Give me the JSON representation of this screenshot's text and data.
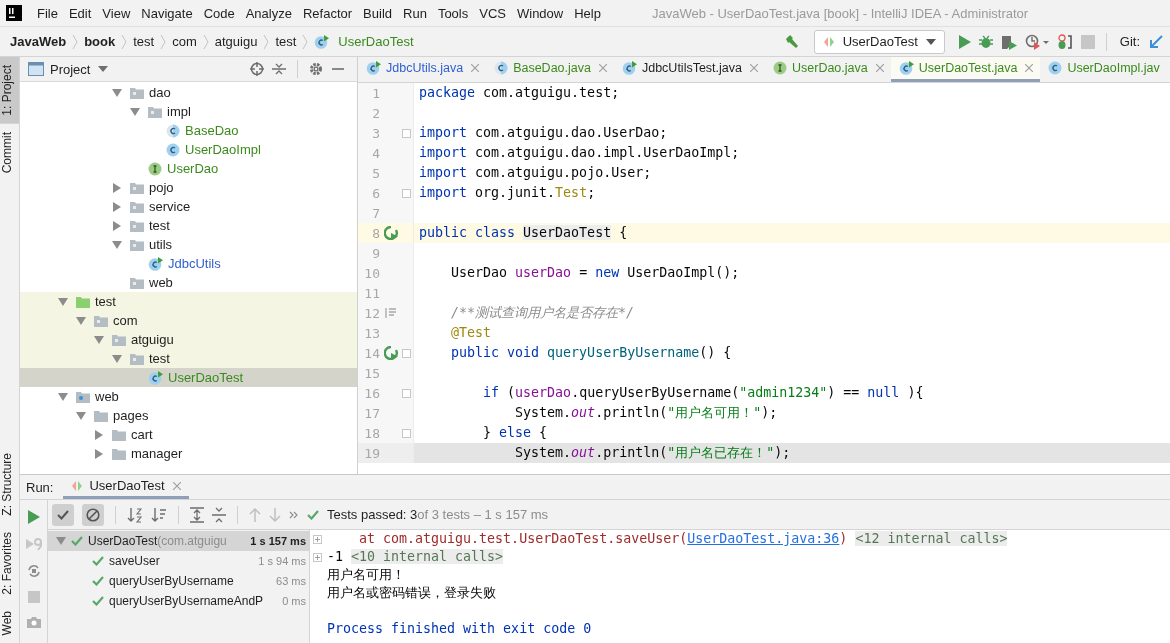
{
  "window": {
    "title": "JavaWeb - UserDaoTest.java [book] - IntelliJ IDEA - Administrator"
  },
  "menu": [
    {
      "label": "File"
    },
    {
      "label": "Edit"
    },
    {
      "label": "View"
    },
    {
      "label": "Navigate"
    },
    {
      "label": "Code"
    },
    {
      "label": "Analyze"
    },
    {
      "label": "Refactor"
    },
    {
      "label": "Build"
    },
    {
      "label": "Run"
    },
    {
      "label": "Tools"
    },
    {
      "label": "VCS"
    },
    {
      "label": "Window"
    },
    {
      "label": "Help"
    }
  ],
  "breadcrumbs": [
    {
      "label": "JavaWeb",
      "kind": "module"
    },
    {
      "label": "book",
      "kind": "module"
    },
    {
      "label": "test",
      "kind": "package"
    },
    {
      "label": "com",
      "kind": "package"
    },
    {
      "label": "atguigu",
      "kind": "package"
    },
    {
      "label": "test",
      "kind": "package"
    },
    {
      "label": "UserDaoTest",
      "kind": "class"
    }
  ],
  "toolbar": {
    "run_config": "UserDaoTest",
    "vcs_label": "Git:",
    "stop_disabled": true
  },
  "side_tabs_top": [
    {
      "label": "1: Project",
      "selected": true
    },
    {
      "label": "Commit",
      "selected": false
    }
  ],
  "side_tabs_bottom": [
    {
      "label": "Z: Structure",
      "selected": false
    },
    {
      "label": "2: Favorites",
      "selected": false
    },
    {
      "label": "Web",
      "selected": false
    }
  ],
  "project": {
    "title": "Project",
    "tree": {
      "scrolled_branch": [
        {
          "name": "dao",
          "kind": "package",
          "expanded": true,
          "selected": false,
          "highlighted": false,
          "color": "#1f1f1f",
          "children": [
            {
              "name": "impl",
              "kind": "package",
              "expanded": true,
              "selected": false,
              "highlighted": false,
              "color": "#1f1f1f",
              "children": [
                {
                  "name": "BaseDao",
                  "kind": "abstract-class",
                  "selected": false,
                  "highlighted": false,
                  "color": "#3b8a1d"
                },
                {
                  "name": "UserDaoImpl",
                  "kind": "class",
                  "selected": false,
                  "highlighted": false,
                  "color": "#3b8a1d"
                }
              ]
            },
            {
              "name": "UserDao",
              "kind": "interface",
              "selected": false,
              "highlighted": false,
              "color": "#3b8a1d"
            }
          ]
        },
        {
          "name": "pojo",
          "kind": "package",
          "expanded": false,
          "selected": false,
          "highlighted": false,
          "color": "#1f1f1f"
        },
        {
          "name": "service",
          "kind": "package",
          "expanded": false,
          "selected": false,
          "highlighted": false,
          "color": "#1f1f1f"
        },
        {
          "name": "test",
          "kind": "package",
          "expanded": false,
          "selected": false,
          "highlighted": false,
          "color": "#1f1f1f"
        },
        {
          "name": "utils",
          "kind": "package",
          "expanded": true,
          "selected": false,
          "highlighted": false,
          "color": "#1f1f1f",
          "children": [
            {
              "name": "JdbcUtils",
              "kind": "runnable-class",
              "selected": false,
              "highlighted": false,
              "color": "#2f5fd0"
            }
          ]
        },
        {
          "name": "web",
          "kind": "package",
          "selected": false,
          "highlighted": false,
          "color": "#1f1f1f"
        }
      ],
      "items": [
        {
          "name": "test",
          "kind": "test-root",
          "expanded": true,
          "selected": false,
          "highlighted": true,
          "color": "#1f1f1f",
          "children": [
            {
              "name": "com",
              "kind": "package",
              "expanded": true,
              "selected": false,
              "highlighted": true,
              "color": "#1f1f1f",
              "children": [
                {
                  "name": "atguigu",
                  "kind": "package",
                  "expanded": true,
                  "selected": false,
                  "highlighted": true,
                  "color": "#1f1f1f",
                  "children": [
                    {
                      "name": "test",
                      "kind": "package",
                      "expanded": true,
                      "selected": false,
                      "highlighted": true,
                      "color": "#1f1f1f",
                      "children": [
                        {
                          "name": "UserDaoTest",
                          "kind": "runnable-class",
                          "selected": true,
                          "highlighted": true,
                          "color": "#3b8a1d"
                        }
                      ]
                    }
                  ]
                }
              ]
            }
          ]
        },
        {
          "name": "web",
          "kind": "web-root",
          "expanded": true,
          "selected": false,
          "highlighted": false,
          "color": "#1f1f1f",
          "children": [
            {
              "name": "pages",
              "kind": "folder",
              "expanded": true,
              "selected": false,
              "highlighted": false,
              "color": "#1f1f1f",
              "children": [
                {
                  "name": "cart",
                  "kind": "folder",
                  "expanded": false,
                  "selected": false,
                  "highlighted": false,
                  "color": "#1f1f1f"
                },
                {
                  "name": "manager",
                  "kind": "folder",
                  "expanded": false,
                  "selected": false,
                  "highlighted": false,
                  "color": "#1f1f1f"
                }
              ]
            }
          ]
        }
      ]
    }
  },
  "editor": {
    "tabs": [
      {
        "label": "JdbcUtils.java",
        "kind": "runnable-class",
        "color": "#2f5fd0",
        "selected": false,
        "closable": true
      },
      {
        "label": "BaseDao.java",
        "kind": "abstract-class",
        "color": "#3b8a1d",
        "selected": false,
        "closable": true
      },
      {
        "label": "JdbcUtilsTest.java",
        "kind": "runnable-class",
        "color": "#1f1f1f",
        "selected": false,
        "closable": true
      },
      {
        "label": "UserDao.java",
        "kind": "interface",
        "color": "#3b8a1d",
        "selected": false,
        "closable": true
      },
      {
        "label": "UserDaoTest.java",
        "kind": "runnable-class",
        "color": "#3b8a1d",
        "selected": true,
        "closable": true
      },
      {
        "label": "UserDaoImpl.jav",
        "kind": "class",
        "color": "#3b8a1d",
        "selected": false,
        "closable": false
      }
    ],
    "lines": [
      {
        "number": "1",
        "run_marker": false,
        "doc_marker": false,
        "fold": false,
        "caret_line": false,
        "selected": false,
        "tokens": [
          {
            "kind": "keyword",
            "text": "package"
          },
          {
            "kind": "plain",
            "text": " com.atguigu.test;"
          }
        ]
      },
      {
        "number": "2",
        "run_marker": false,
        "doc_marker": false,
        "fold": false,
        "caret_line": false,
        "selected": false
      },
      {
        "number": "3",
        "run_marker": false,
        "doc_marker": false,
        "fold": true,
        "caret_line": false,
        "selected": false,
        "tokens": [
          {
            "kind": "keyword",
            "text": "import"
          },
          {
            "kind": "plain",
            "text": " com.atguigu.dao.UserDao;"
          }
        ]
      },
      {
        "number": "4",
        "run_marker": false,
        "doc_marker": false,
        "fold": false,
        "caret_line": false,
        "selected": false,
        "tokens": [
          {
            "kind": "keyword",
            "text": "import"
          },
          {
            "kind": "plain",
            "text": " com.atguigu.dao.impl.UserDaoImpl;"
          }
        ]
      },
      {
        "number": "5",
        "run_marker": false,
        "doc_marker": false,
        "fold": false,
        "caret_line": false,
        "selected": false,
        "tokens": [
          {
            "kind": "keyword",
            "text": "import"
          },
          {
            "kind": "plain",
            "text": " com.atguigu.pojo.User;"
          }
        ]
      },
      {
        "number": "6",
        "run_marker": false,
        "doc_marker": false,
        "fold": true,
        "caret_line": false,
        "selected": false,
        "tokens": [
          {
            "kind": "keyword",
            "text": "import"
          },
          {
            "kind": "plain",
            "text": " org.junit."
          },
          {
            "kind": "annotation",
            "text": "Test"
          },
          {
            "kind": "plain",
            "text": ";"
          }
        ]
      },
      {
        "number": "7",
        "run_marker": false,
        "doc_marker": false,
        "fold": false,
        "caret_line": false,
        "selected": false
      },
      {
        "number": "8",
        "run_marker": true,
        "doc_marker": false,
        "fold": false,
        "caret_line": true,
        "selected": false,
        "tokens": [
          {
            "kind": "keyword",
            "text": "public class "
          },
          {
            "kind": "usage",
            "text": "UserDaoTest"
          },
          {
            "kind": "plain",
            "text": " {"
          }
        ]
      },
      {
        "number": "9",
        "run_marker": false,
        "doc_marker": false,
        "fold": false,
        "caret_line": false,
        "selected": false
      },
      {
        "number": "10",
        "run_marker": false,
        "doc_marker": false,
        "fold": false,
        "caret_line": false,
        "selected": false,
        "tokens": [
          {
            "kind": "plain",
            "text": "    UserDao "
          },
          {
            "kind": "field",
            "text": "userDao"
          },
          {
            "kind": "plain",
            "text": " = "
          },
          {
            "kind": "keyword",
            "text": "new"
          },
          {
            "kind": "plain",
            "text": " UserDaoImpl();"
          }
        ]
      },
      {
        "number": "11",
        "run_marker": false,
        "doc_marker": false,
        "fold": false,
        "caret_line": false,
        "selected": false
      },
      {
        "number": "12",
        "run_marker": false,
        "doc_marker": true,
        "fold": false,
        "caret_line": false,
        "selected": false,
        "tokens": [
          {
            "kind": "comment",
            "text": "    /**测试查询用户名是否存在*/"
          }
        ]
      },
      {
        "number": "13",
        "run_marker": false,
        "doc_marker": false,
        "fold": false,
        "caret_line": false,
        "selected": false,
        "tokens": [
          {
            "kind": "annotation",
            "text": "    @Test"
          }
        ]
      },
      {
        "number": "14",
        "run_marker": true,
        "doc_marker": false,
        "fold": true,
        "caret_line": false,
        "selected": false,
        "tokens": [
          {
            "kind": "keyword",
            "text": "    public void "
          },
          {
            "kind": "method",
            "text": "queryUserByUsername"
          },
          {
            "kind": "plain",
            "text": "() {"
          }
        ]
      },
      {
        "number": "15",
        "run_marker": false,
        "doc_marker": false,
        "fold": false,
        "caret_line": false,
        "selected": false
      },
      {
        "number": "16",
        "run_marker": false,
        "doc_marker": false,
        "fold": true,
        "caret_line": false,
        "selected": false,
        "tokens": [
          {
            "kind": "keyword",
            "text": "        if"
          },
          {
            "kind": "plain",
            "text": " ("
          },
          {
            "kind": "field",
            "text": "userDao"
          },
          {
            "kind": "plain",
            "text": ".queryUserByUsername("
          },
          {
            "kind": "string",
            "text": "\"admin1234\""
          },
          {
            "kind": "plain",
            "text": ") == "
          },
          {
            "kind": "keyword",
            "text": "null"
          },
          {
            "kind": "plain",
            "text": " ){"
          }
        ]
      },
      {
        "number": "17",
        "run_marker": false,
        "doc_marker": false,
        "fold": false,
        "caret_line": false,
        "selected": false,
        "tokens": [
          {
            "kind": "plain",
            "text": "            System."
          },
          {
            "kind": "static",
            "text": "out"
          },
          {
            "kind": "plain",
            "text": ".println("
          },
          {
            "kind": "string",
            "text": "\"用户名可用！\""
          },
          {
            "kind": "plain",
            "text": ");"
          }
        ]
      },
      {
        "number": "18",
        "run_marker": false,
        "doc_marker": false,
        "fold": true,
        "caret_line": false,
        "selected": false,
        "tokens": [
          {
            "kind": "plain",
            "text": "        } "
          },
          {
            "kind": "keyword",
            "text": "else"
          },
          {
            "kind": "plain",
            "text": " {"
          }
        ]
      },
      {
        "number": "19",
        "run_marker": false,
        "doc_marker": false,
        "fold": false,
        "caret_line": false,
        "selected": true,
        "tokens": [
          {
            "kind": "plain",
            "text": "            System."
          },
          {
            "kind": "static",
            "text": "out"
          },
          {
            "kind": "plain",
            "text": ".println("
          },
          {
            "kind": "string",
            "text": "\"用户名已存在！\""
          },
          {
            "kind": "plain",
            "text": ");"
          }
        ]
      }
    ]
  },
  "run": {
    "label": "Run:",
    "tab": {
      "label": "UserDaoTest",
      "selected": true
    },
    "filters": {
      "show_passed": true,
      "show_ignored": true
    },
    "status": {
      "summary": "Tests passed: 3",
      "detail": "of 3 tests – 1 s 157 ms"
    },
    "tests": [
      {
        "name": "UserDaoTest",
        "detail": "(com.atguigu",
        "time": "1 s 157 ms",
        "passed": true,
        "selected": true,
        "children": [
          {
            "name": "saveUser",
            "time": "1 s 94 ms",
            "passed": true,
            "selected": false
          },
          {
            "name": "queryUserByUsername",
            "time": "63 ms",
            "passed": true,
            "selected": false
          },
          {
            "name": "queryUserByUsernameAndP",
            "time": "0 ms",
            "passed": true,
            "selected": false
          }
        ]
      }
    ],
    "console": [
      {
        "fold": true,
        "segments": [
          {
            "kind": "error",
            "text": "    at com.atguigu.test.UserDaoTest.saveUser("
          },
          {
            "kind": "link",
            "text": "UserDaoTest.java:36"
          },
          {
            "kind": "error",
            "text": ")"
          },
          {
            "kind": "internal",
            "text": "<12 internal calls>"
          }
        ]
      },
      {
        "fold": true,
        "segments": [
          {
            "kind": "plain",
            "text": "-1"
          },
          {
            "kind": "internal",
            "text": "<10 internal calls>"
          }
        ]
      },
      {
        "segments": [
          {
            "kind": "plain",
            "text": "用户名可用！"
          }
        ]
      },
      {
        "segments": [
          {
            "kind": "plain",
            "text": "用户名或密码错误，登录失败"
          }
        ]
      },
      {
        "gap_before": true,
        "segments": [
          {
            "kind": "info",
            "text": "Process finished with exit code 0"
          }
        ]
      }
    ]
  }
}
